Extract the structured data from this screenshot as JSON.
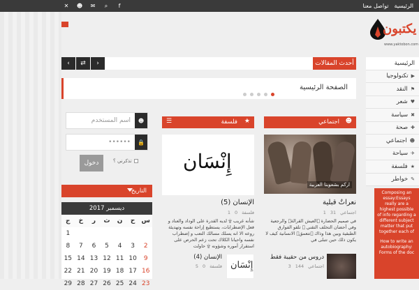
{
  "topbar": {
    "nav": [
      "الرئيسية",
      "تواصل معنا"
    ],
    "social_icons": [
      "facebook-icon",
      "search-icon",
      "mail-icon",
      "user-icon",
      "twitter-icon"
    ]
  },
  "logo": {
    "word": "يكتبون",
    "url": "www.yaktobon.com"
  },
  "latest": {
    "label": "أحدث المقالات",
    "prev": "‹",
    "shuffle": "⇄",
    "next": "›"
  },
  "slide": {
    "title": "الصفحة الرئيسية"
  },
  "menu": [
    {
      "label": "الرئيسية",
      "icon": ""
    },
    {
      "label": "تكنولوجيا",
      "icon": "▶"
    },
    {
      "label": "النقد",
      "icon": "⚑"
    },
    {
      "label": "شعر",
      "icon": "♥"
    },
    {
      "label": "سياسة",
      "icon": "✖"
    },
    {
      "label": "صحة",
      "icon": "✚"
    },
    {
      "label": "اجتماعي",
      "icon": "☻"
    },
    {
      "label": "سياحة",
      "icon": "✈"
    },
    {
      "label": "فلسفة",
      "icon": "★"
    },
    {
      "label": "خواطر",
      "icon": "✎"
    }
  ],
  "ad": {
    "p1": "Composing an essay:Essays really are a highest possible of info regarding a different subject matter that put together each of",
    "p2": "How to write an autobiography: Forms of the doc"
  },
  "login": {
    "username_placeholder": "اسم المستخدم",
    "password_placeholder": "••••••",
    "button": "دخول",
    "remember": "تذكرني ؟"
  },
  "calendar": {
    "header": "التاريخ",
    "month": "ديسمبر 2017",
    "weekdays": [
      "س",
      "ح",
      "ن",
      "ث",
      "ر",
      "خ",
      "ج"
    ],
    "rows": [
      [
        "",
        "",
        "",
        "",
        "",
        "",
        "1"
      ],
      [
        "2",
        "3",
        "4",
        "5",
        "6",
        "7",
        "8"
      ],
      [
        "9",
        "10",
        "11",
        "12",
        "13",
        "14",
        "15"
      ],
      [
        "16",
        "17",
        "18",
        "19",
        "20",
        "21",
        "22"
      ],
      [
        "23",
        "24",
        "25",
        "26",
        "27",
        "28",
        "29"
      ]
    ]
  },
  "blocks": {
    "social": {
      "head": "اجتماعي",
      "photo_caption": "اركم بشعوبنا العربية",
      "title": "نعراتٌ قبلية",
      "meta": [
        "اجتماعي",
        "31",
        "1"
      ],
      "excerpt": "في صميم الحضارة ۩العيش القرالةۜ والرجعية وفي أحضان التخلف التقني ۩ تلقو الفوارق الطبقية وبين هذا وذاك ۩تتعمقۜ الانسانية كيف لا يكون ذلك حين تتبلى في",
      "item2_title": "دروس من حقيبة فقط",
      "item2_meta": [
        "اجتماعي",
        "144",
        "3"
      ]
    },
    "philosophy": {
      "head": "فلسفة",
      "image_word": "إِنْسَان",
      "title": "الإنسان (5)",
      "meta": [
        "فلسفة",
        "0",
        "1"
      ],
      "excerpt": "شأنه غريب ۩ لديه القدرة على الوداد والعناد و فعل الإضطرابات، يستطيع إزاحة نفسه وتهديئة روعه الا انه يسلك مسالك التعب و إضطراب نفسه واحيانا الكلاك تحت زعم الحرص على استقرار أموره وشؤونه ۩ حاولت",
      "item2_title": "الإنسان (4)",
      "item2_meta": [
        "فلسفة",
        "0",
        "5"
      ],
      "thumb_word": "إِنْسَان"
    }
  }
}
